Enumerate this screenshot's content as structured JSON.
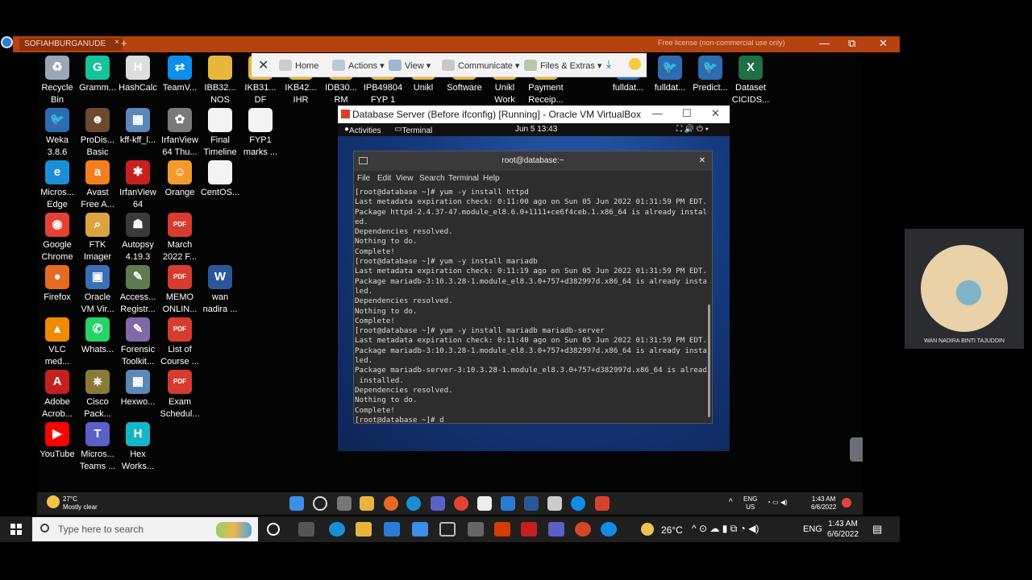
{
  "titlebar": {
    "tab_label": "SOFIAHBURGANUDE",
    "tab_close": "×",
    "new_tab": "+",
    "license": "Free license (non-commercial use only)",
    "minimize": "—",
    "restore": "⧉",
    "close": "✕"
  },
  "desktop_icons": [
    {
      "label": "Recycle\nBin",
      "color": "#9aa7b5",
      "glyph": "♻"
    },
    {
      "label": "Gramm...",
      "color": "#15c39a",
      "glyph": "G"
    },
    {
      "label": "HashCalc",
      "color": "#dddddd",
      "glyph": "H"
    },
    {
      "label": "TeamV...",
      "color": "#0e8ee9",
      "glyph": "⇄"
    },
    {
      "label": "IBB32...\nNOS",
      "color": "#e6b73c",
      "glyph": ""
    },
    {
      "label": "IKB31...\nDF",
      "color": "#e6b73c",
      "glyph": ""
    },
    {
      "label": "IKB42...\nIHR",
      "color": "#e6b73c",
      "glyph": ""
    },
    {
      "label": "IDB30...\nRM",
      "color": "#e6b73c",
      "glyph": ""
    },
    {
      "label": "IPB49804\nFYP 1",
      "color": "#e6b73c",
      "glyph": ""
    },
    {
      "label": "Unikl",
      "color": "#e6b73c",
      "glyph": ""
    },
    {
      "label": "Software",
      "color": "#e6b73c",
      "glyph": ""
    },
    {
      "label": "Unikl\nWork",
      "color": "#e6b73c",
      "glyph": ""
    },
    {
      "label": "Payment\nReceip...",
      "color": "#e6b73c",
      "glyph": ""
    },
    {
      "label": "fulldat...",
      "color": "#2b6cb3",
      "glyph": "🐦"
    },
    {
      "label": "fulldat...",
      "color": "#2b6cb3",
      "glyph": "🐦"
    },
    {
      "label": "Predict...",
      "color": "#2b6cb3",
      "glyph": "🐦"
    },
    {
      "label": "Dataset\nCICIDS...",
      "color": "#1d7044",
      "glyph": "X"
    },
    {
      "label": "Weka\n3.8.6",
      "color": "#2b6cb3",
      "glyph": "🐦"
    },
    {
      "label": "ProDis...\nBasic",
      "color": "#6b4a2e",
      "glyph": "☻"
    },
    {
      "label": "kff-kff_l...",
      "color": "#5b88b8",
      "glyph": "▦"
    },
    {
      "label": "IrfanView\n64 Thu...",
      "color": "#7a7a7a",
      "glyph": "✿"
    },
    {
      "label": "Final\nTimeline",
      "color": "#f4f4f4",
      "glyph": ""
    },
    {
      "label": "FYP1\nmarks ...",
      "color": "#f4f4f4",
      "glyph": ""
    },
    {
      "label": "Micros...\nEdge",
      "color": "#1b8fd6",
      "glyph": "e"
    },
    {
      "label": "Avast\nFree A...",
      "color": "#f27e1f",
      "glyph": "a"
    },
    {
      "label": "IrfanView\n64",
      "color": "#c8201f",
      "glyph": "✱"
    },
    {
      "label": "Orange",
      "color": "#f19b2c",
      "glyph": "☺"
    },
    {
      "label": "CentOS...",
      "color": "#f4f4f4",
      "glyph": ""
    },
    {
      "label": "Google\nChrome",
      "color": "#e34133",
      "glyph": "◉"
    },
    {
      "label": "FTK\nImager",
      "color": "#d9a441",
      "glyph": "⌕"
    },
    {
      "label": "Autopsy\n4.19.3",
      "color": "#3a3a3a",
      "glyph": "☗"
    },
    {
      "label": "March\n2022 F...",
      "color": "#d63b2f",
      "glyph": "PDF"
    },
    {
      "label": "Firefox",
      "color": "#e66a1f",
      "glyph": "●"
    },
    {
      "label": "Oracle\nVM Vir...",
      "color": "#3a6fb7",
      "glyph": "▣"
    },
    {
      "label": "Access...\nRegistr...",
      "color": "#5d7b4e",
      "glyph": "✎"
    },
    {
      "label": "MEMO\nONLIN...",
      "color": "#d63b2f",
      "glyph": "PDF"
    },
    {
      "label": "wan\nnadira ...",
      "color": "#2b5797",
      "glyph": "W"
    },
    {
      "label": "VLC\nmed...",
      "color": "#f08a00",
      "glyph": "▲"
    },
    {
      "label": "Whats...",
      "color": "#25d366",
      "glyph": "✆"
    },
    {
      "label": "Forensic\nToolkit...",
      "color": "#7e6aa8",
      "glyph": "✎"
    },
    {
      "label": "List of\nCourse ...",
      "color": "#d63b2f",
      "glyph": "PDF"
    },
    {
      "label": "Adobe\nAcrob...",
      "color": "#c51f1f",
      "glyph": "A"
    },
    {
      "label": "Cisco\nPack...",
      "color": "#8a7a3a",
      "glyph": "⎈"
    },
    {
      "label": "Hexwo...",
      "color": "#5b88b8",
      "glyph": "▦"
    },
    {
      "label": "Exam\nSchedul...",
      "color": "#d63b2f",
      "glyph": "PDF"
    },
    {
      "label": "YouTube",
      "color": "#ff0000",
      "glyph": "▶"
    },
    {
      "label": "Micros...\nTeams ...",
      "color": "#5b5fc7",
      "glyph": "T"
    },
    {
      "label": "Hex\nWorks...",
      "color": "#16b6c9",
      "glyph": "H"
    }
  ],
  "teamviewer_toolbar": {
    "home": "Home",
    "actions": "Actions",
    "view": "View",
    "communicate": "Communicate",
    "files": "Files & Extras"
  },
  "vbox": {
    "title": "Database Server (Before ifconfig) [Running] - Oracle VM VirtualBox",
    "activities": "Activities",
    "terminal_app": "Terminal ▾",
    "clock": "Jun 5  13:43",
    "tray": "⛶  🔊  ⏻ ▾"
  },
  "terminal": {
    "title": "root@database:~",
    "menu": [
      "File",
      "Edit",
      "View",
      "Search",
      "Terminal",
      "Help"
    ],
    "lines": [
      "[root@database ~]# yum -y install httpd",
      "Last metadata expiration check: 0:11:00 ago on Sun 05 Jun 2022 01:31:59 PM EDT.",
      "Package httpd-2.4.37-47.module_el8.6.0+1111+ce6f4ceb.1.x86_64 is already install",
      "ed.",
      "Dependencies resolved.",
      "Nothing to do.",
      "Complete!",
      "[root@database ~]# yum -y install mariadb",
      "Last metadata expiration check: 0:11:19 ago on Sun 05 Jun 2022 01:31:59 PM EDT.",
      "Package mariadb-3:10.3.28-1.module_el8.3.0+757+d382997d.x86_64 is already instal",
      "led.",
      "Dependencies resolved.",
      "Nothing to do.",
      "Complete!",
      "[root@database ~]# yum -y install mariadb mariadb-server",
      "Last metadata expiration check: 0:11:40 ago on Sun 05 Jun 2022 01:31:59 PM EDT.",
      "Package mariadb-3:10.3.28-1.module_el8.3.0+757+d382997d.x86_64 is already instal",
      "led.",
      "Package mariadb-server-3:10.3.28-1.module_el8.3.0+757+d382997d.x86_64 is already",
      " installed.",
      "Dependencies resolved.",
      "Nothing to do.",
      "Complete!",
      "[root@database ~]# d"
    ]
  },
  "participant": {
    "name": "WAN NADIRA BINTI TAJUDDIN"
  },
  "inner_taskbar": {
    "weather_temp": "27°C",
    "weather_desc": "Mostly clear",
    "lang_top": "ENG",
    "lang_bottom": "US",
    "time": "1:43 AM",
    "date": "6/6/2022"
  },
  "host_taskbar": {
    "search_placeholder": "Type here to search",
    "weather": "26°C",
    "lang": "ENG",
    "time": "1:43 AM",
    "date": "6/6/2022"
  }
}
